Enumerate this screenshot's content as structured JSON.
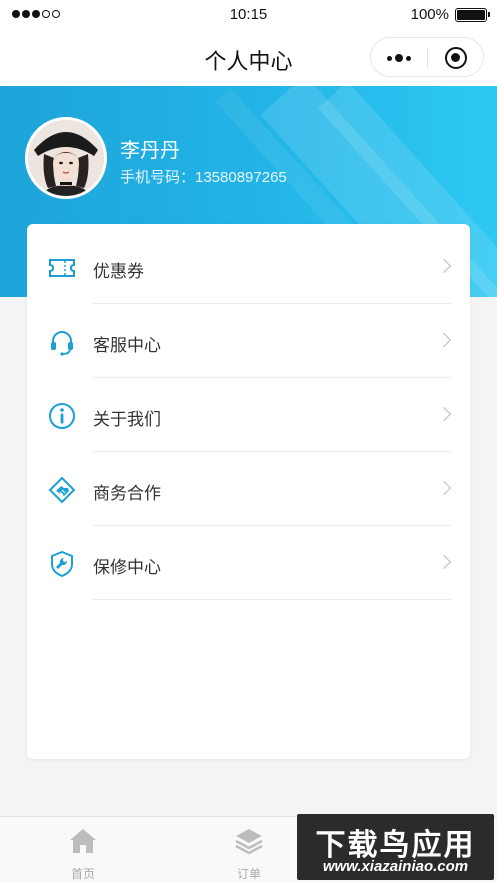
{
  "status_bar": {
    "time": "10:15",
    "battery": "100%"
  },
  "nav": {
    "title": "个人中心"
  },
  "user": {
    "name": "李丹丹",
    "phone": "手机号码：13580897265"
  },
  "menu": [
    {
      "label": "优惠券",
      "icon": "ticket-icon"
    },
    {
      "label": "客服中心",
      "icon": "headset-icon"
    },
    {
      "label": "关于我们",
      "icon": "info-icon"
    },
    {
      "label": "商务合作",
      "icon": "handshake-icon"
    },
    {
      "label": "保修中心",
      "icon": "shield-wrench-icon"
    }
  ],
  "tabs": [
    {
      "label": "首页",
      "icon": "home-icon"
    },
    {
      "label": "订单",
      "icon": "layers-icon"
    }
  ],
  "watermark": {
    "title": "下载鸟应用",
    "url": "www.xiazainiao.com"
  },
  "colors": {
    "accent": "#1ea4d8",
    "accent_light": "#2ec8f3",
    "icon": "#1a9fd6"
  }
}
